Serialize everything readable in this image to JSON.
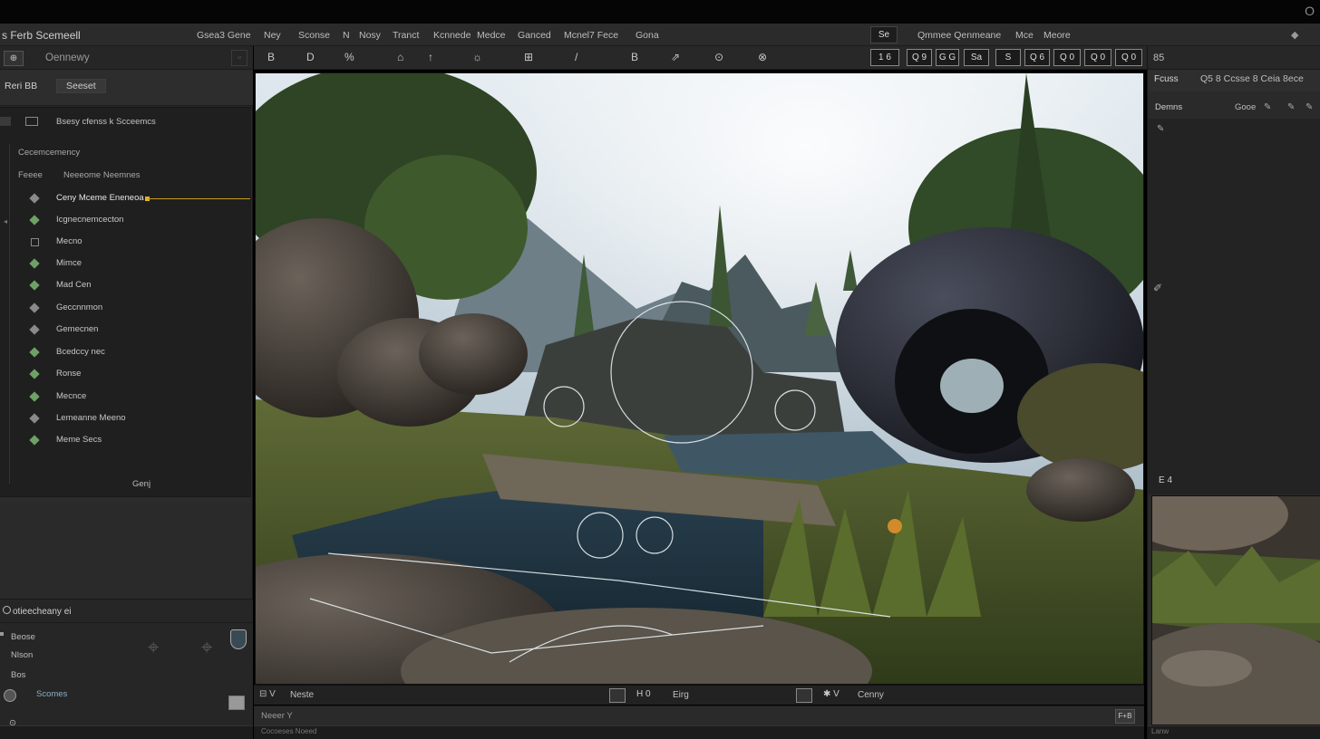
{
  "window": {
    "corner_glyph": "O"
  },
  "menubar": {
    "app_title": "s Ferb Scemeell",
    "items": [
      "Gsea3 Gene",
      "Ney",
      "Sconse",
      "N",
      "Nosy",
      "Tranct",
      "Kcnnede",
      "Medce",
      "Ganced",
      "Mcnel7 Fece",
      "Gona"
    ],
    "right_badge": "Se",
    "right_items": [
      "Qmmee Qenmeane",
      "Mce",
      "Meore"
    ]
  },
  "left_panel": {
    "header_icon": "⊕",
    "header_title": "Oennewy",
    "tabs": [
      "Reri BB",
      "Seeset"
    ],
    "outliner": {
      "root_label": "Bsesy cfenss k Scceemcs",
      "sub1": "Cecemcemency",
      "sub2_a": "Feeee",
      "sub2_b": "Neeeome Neemnes",
      "items": [
        {
          "label": "Ceny Mceme Eneneoa",
          "icon": "gray",
          "selected": true
        },
        {
          "label": "Icgnecnemcecton",
          "icon": "green",
          "selected": false
        },
        {
          "label": "Mecno",
          "icon": "square",
          "selected": false
        },
        {
          "label": "Mimce",
          "icon": "green",
          "selected": false
        },
        {
          "label": "Mad Cen",
          "icon": "green",
          "selected": false
        },
        {
          "label": "Geccnnmon",
          "icon": "gray",
          "selected": false
        },
        {
          "label": "Gemecnen",
          "icon": "gray",
          "selected": false
        },
        {
          "label": "Bcedccy nec",
          "icon": "green",
          "selected": false
        },
        {
          "label": "Ronse",
          "icon": "green",
          "selected": false
        },
        {
          "label": "Mecnce",
          "icon": "green",
          "selected": false
        },
        {
          "label": "Lemeanne Meeno",
          "icon": "gray",
          "selected": false
        },
        {
          "label": "Meme Secs",
          "icon": "green",
          "selected": false
        }
      ],
      "footer": "Genj"
    },
    "details": {
      "title": "otieecheany ei",
      "fields": [
        "Beose",
        "Nlson",
        "Bos",
        "Scomes"
      ],
      "bottom_icon": "⊙"
    },
    "bottom_bar": "Cocoeses Noeed"
  },
  "toolbar": {
    "buttons": [
      "B",
      "D",
      "%",
      "⌂",
      "↑",
      "☼",
      "⊞",
      "/",
      "B",
      "⇗",
      "⊙",
      "⊗"
    ],
    "chips": [
      "1 6",
      "Q 9",
      "G G",
      "Sa",
      "S",
      "Q 6",
      "Q 0",
      "Q 0",
      "Q 0"
    ]
  },
  "viewport_bar": {
    "left_label": "Neste",
    "middle_label": "Eirg",
    "right_label": "Cenny"
  },
  "content_bar": {
    "label": "Neeer Y",
    "btn": "F+B"
  },
  "right_panel": {
    "header": "85",
    "row1_label": "Fcuss",
    "row1_value": "Q5 8 Ccsse 8 Ceia 8ece",
    "row2_label": "Demns",
    "row2_value": "Gooe",
    "foot": "E 4",
    "bottom": "Lanw"
  },
  "colors": {
    "accent": "#c99a1c",
    "panel": "#2a2a2a",
    "panel_dark": "#1f1f1f",
    "tree_green": "#6ea166"
  }
}
